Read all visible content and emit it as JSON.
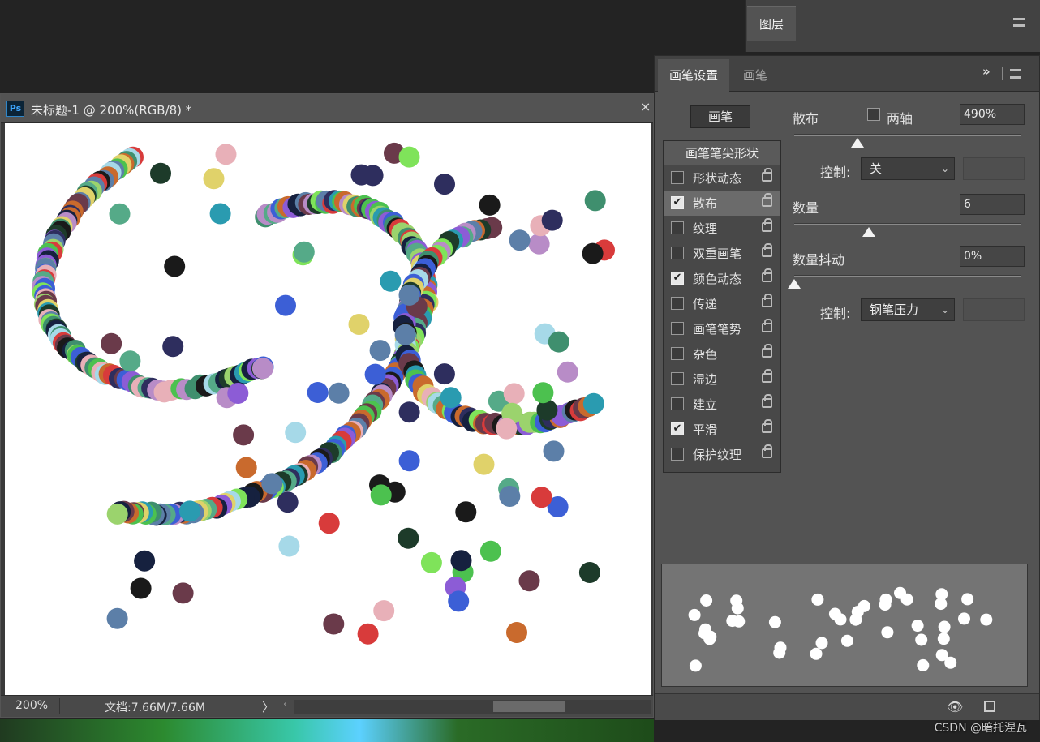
{
  "layers_panel": {
    "tab": "图层"
  },
  "document": {
    "badge": "Ps",
    "title": "未标题-1 @ 200%(RGB/8) *",
    "close": "×",
    "zoom": "200%",
    "doc_size": "文档:7.66M/7.66M",
    "status_arrow": "〉",
    "scroll_left": "‹"
  },
  "brush_panel": {
    "tabs": [
      "画笔设置",
      "画笔"
    ],
    "expand": "»",
    "presets_button": "画笔",
    "tip_shape": "画笔笔尖形状",
    "options": [
      {
        "label": "形状动态",
        "checked": false
      },
      {
        "label": "散布",
        "checked": true
      },
      {
        "label": "纹理",
        "checked": false
      },
      {
        "label": "双重画笔",
        "checked": false
      },
      {
        "label": "颜色动态",
        "checked": true
      },
      {
        "label": "传递",
        "checked": false
      },
      {
        "label": "画笔笔势",
        "checked": false
      },
      {
        "label": "杂色",
        "checked": false
      },
      {
        "label": "湿边",
        "checked": false
      },
      {
        "label": "建立",
        "checked": false
      },
      {
        "label": "平滑",
        "checked": true
      },
      {
        "label": "保护纹理",
        "checked": false
      }
    ],
    "scatter": {
      "label": "散布",
      "both_axes": "两轴",
      "both_axes_checked": false,
      "value": "490%",
      "slider": 0.28
    },
    "control1": {
      "label": "控制:",
      "value": "关"
    },
    "count": {
      "label": "数量",
      "value": "6",
      "slider": 0.33
    },
    "count_jitter": {
      "label": "数量抖动",
      "value": "0%",
      "slider": 0.0
    },
    "control2": {
      "label": "控制:",
      "value": "钢笔压力"
    }
  },
  "watermark": "CSDN @暗托涅瓦"
}
